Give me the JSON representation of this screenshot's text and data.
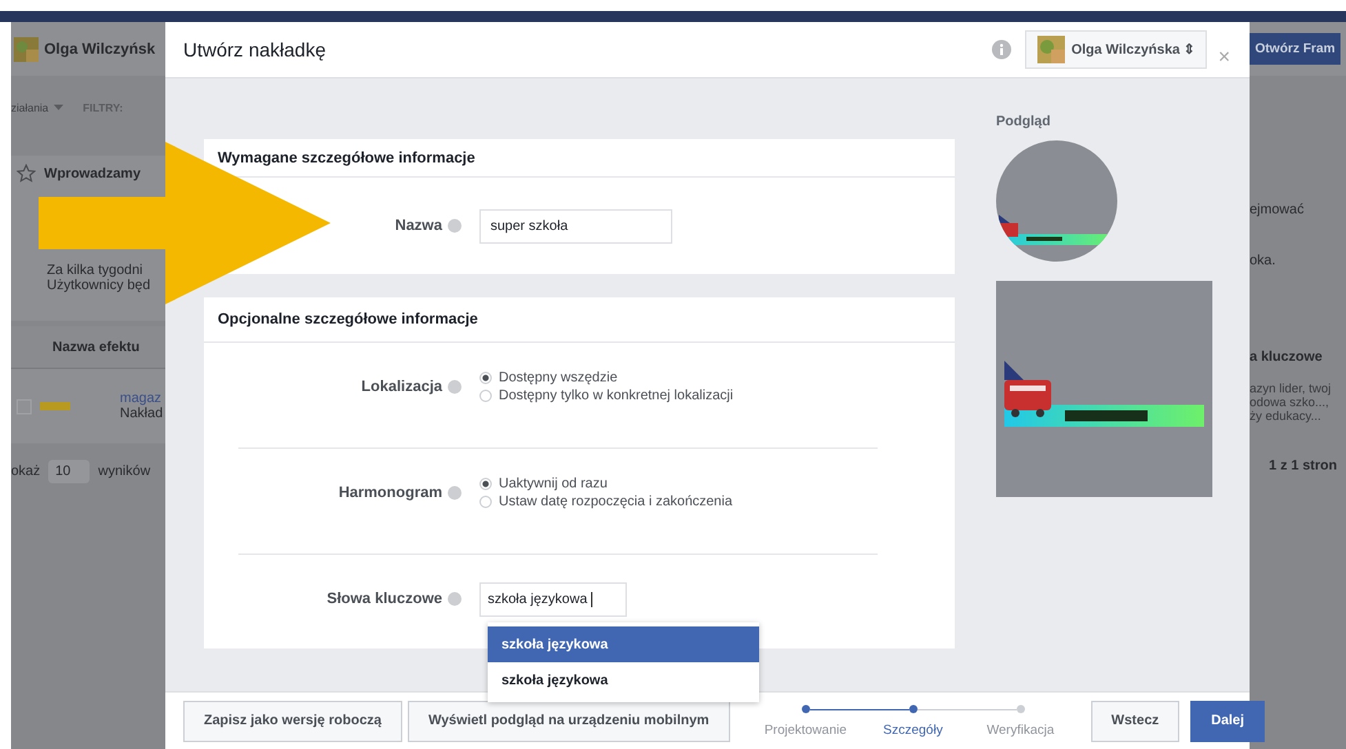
{
  "background": {
    "profile_name": "Olga Wilczyńsk",
    "actions_menu": "ziałania",
    "filters_label": "FILTRY:",
    "notice_title": "Wprowadzamy",
    "notice_lines": [
      "Za kilka tygodni",
      "Użytkownicy będ"
    ],
    "table_header": "Nazwa efektu",
    "row_checked": false,
    "row_link": "magaz",
    "row_text": "Nakład",
    "show_label": "okaż",
    "page_size": "10",
    "results_label": "wyników",
    "open_button": "Otwórz Fram",
    "right_texts": [
      "ejmować",
      "oka."
    ],
    "right_header": "a kluczowe",
    "right_cell_lines": [
      "azyn lider, twoj",
      "odowa szko...,",
      "ży edukacy..."
    ],
    "pagination": "1 z 1 stron"
  },
  "dialog": {
    "title": "Utwórz nakładkę",
    "account": "Olga Wilczyńska ⇕",
    "close": "×"
  },
  "required": {
    "title": "Wymagane szczegółowe informacje",
    "name_label": "Nazwa",
    "name_value": "super szkoła"
  },
  "optional": {
    "title": "Opcjonalne szczegółowe informacje",
    "groups": [
      {
        "label": "Lokalizacja",
        "options": [
          {
            "label": "Dostępny wszędzie",
            "selected": true
          },
          {
            "label": "Dostępny tylko w konkretnej lokalizacji",
            "selected": false
          }
        ]
      },
      {
        "label": "Harmonogram",
        "options": [
          {
            "label": "Uaktywnij od razu",
            "selected": true
          },
          {
            "label": "Ustaw datę rozpoczęcia i zakończenia",
            "selected": false
          }
        ]
      }
    ],
    "keywords_label": "Słowa kluczowe",
    "keywords_value": "szkoła językowa",
    "suggestions": [
      {
        "label": "szkoła językowa",
        "selected": true
      },
      {
        "label": "szkoła językowa",
        "selected": false
      }
    ]
  },
  "preview": {
    "title": "Podgląd"
  },
  "footer": {
    "save_draft": "Zapisz jako wersję roboczą",
    "mobile_preview": "Wyświetl podgląd na urządzeniu mobilnym",
    "steps": [
      {
        "label": "Projektowanie",
        "completed": true,
        "selected": false
      },
      {
        "label": "Szczegóły",
        "completed": true,
        "selected": true
      },
      {
        "label": "Weryfikacja",
        "completed": false,
        "selected": false
      }
    ],
    "back": "Wstecz",
    "next": "Dalej"
  }
}
